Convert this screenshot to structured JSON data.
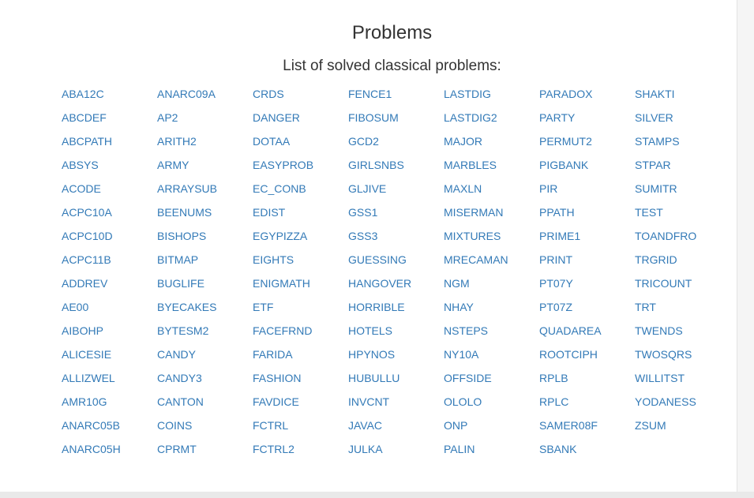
{
  "page": {
    "title": "Problems",
    "subtitle": "List of solved classical problems:"
  },
  "colors": {
    "link": "#337ab7",
    "text": "#333333",
    "background": "#ffffff"
  },
  "problems": [
    "ABA12C",
    "ABCDEF",
    "ABCPATH",
    "ABSYS",
    "ACODE",
    "ACPC10A",
    "ACPC10D",
    "ACPC11B",
    "ADDREV",
    "AE00",
    "AIBOHP",
    "ALICESIE",
    "ALLIZWEL",
    "AMR10G",
    "ANARC05B",
    "ANARC05H",
    "ANARC09A",
    "AP2",
    "ARITH2",
    "ARMY",
    "ARRAYSUB",
    "BEENUMS",
    "BISHOPS",
    "BITMAP",
    "BUGLIFE",
    "BYECAKES",
    "BYTESM2",
    "CANDY",
    "CANDY3",
    "CANTON",
    "COINS",
    "CPRMT",
    "CRDS",
    "DANGER",
    "DOTAA",
    "EASYPROB",
    "EC_CONB",
    "EDIST",
    "EGYPIZZA",
    "EIGHTS",
    "ENIGMATH",
    "ETF",
    "FACEFRND",
    "FARIDA",
    "FASHION",
    "FAVDICE",
    "FCTRL",
    "FCTRL2",
    "FENCE1",
    "FIBOSUM",
    "GCD2",
    "GIRLSNBS",
    "GLJIVE",
    "GSS1",
    "GSS3",
    "GUESSING",
    "HANGOVER",
    "HORRIBLE",
    "HOTELS",
    "HPYNOS",
    "HUBULLU",
    "INVCNT",
    "JAVAC",
    "JULKA",
    "LASTDIG",
    "LASTDIG2",
    "MAJOR",
    "MARBLES",
    "MAXLN",
    "MISERMAN",
    "MIXTURES",
    "MRECAMAN",
    "NGM",
    "NHAY",
    "NSTEPS",
    "NY10A",
    "OFFSIDE",
    "OLOLO",
    "ONP",
    "PALIN",
    "PARADOX",
    "PARTY",
    "PERMUT2",
    "PIGBANK",
    "PIR",
    "PPATH",
    "PRIME1",
    "PRINT",
    "PT07Y",
    "PT07Z",
    "QUADAREA",
    "ROOTCIPH",
    "RPLB",
    "RPLC",
    "SAMER08F",
    "SBANK",
    "SHAKTI",
    "SILVER",
    "STAMPS",
    "STPAR",
    "SUMITR",
    "TEST",
    "TOANDFRO",
    "TRGRID",
    "TRICOUNT",
    "TRT",
    "TWENDS",
    "TWOSQRS",
    "WILLITST",
    "YODANESS",
    "ZSUM"
  ]
}
